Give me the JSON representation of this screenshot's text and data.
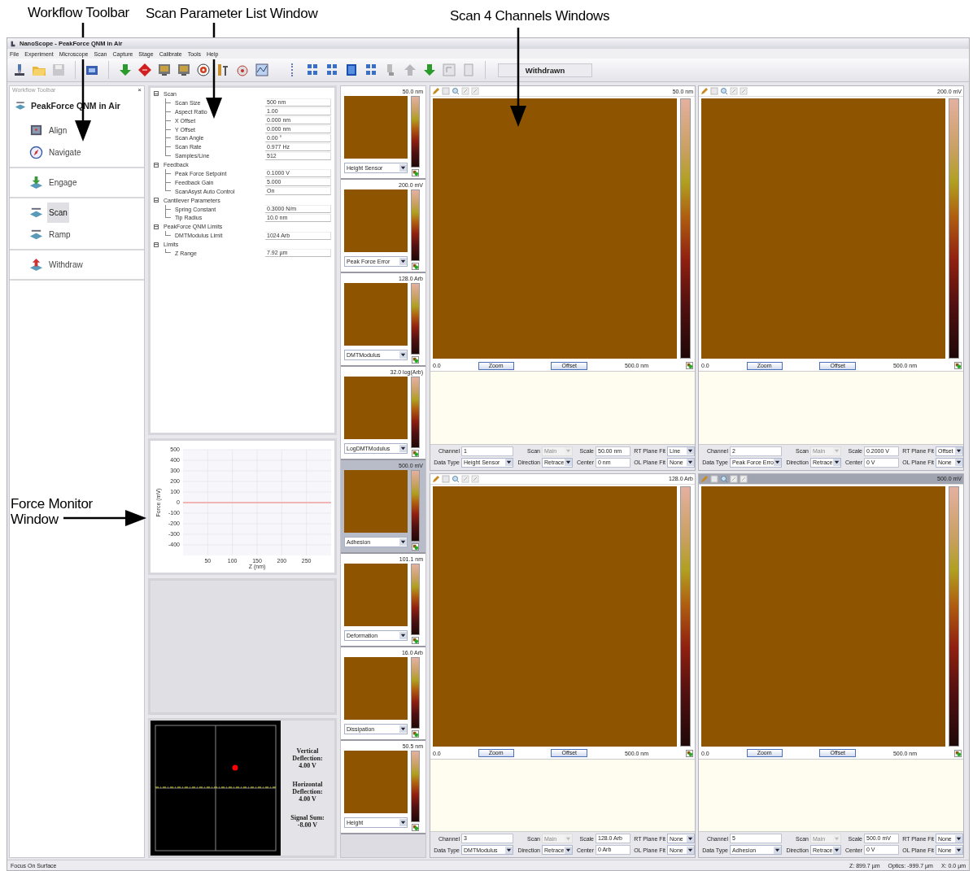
{
  "annotations": {
    "workflow_label": "Workflow Toolbar",
    "params_label": "Scan Parameter List Window",
    "channels_label": "Scan 4 Channels Windows",
    "force_label": "Force Monitor Window"
  },
  "window": {
    "title": "NanoScope - PeakForce QNM in Air"
  },
  "menu": [
    "File",
    "Experiment",
    "Microscope",
    "Scan",
    "Capture",
    "Stage",
    "Calibrate",
    "Tools",
    "Help"
  ],
  "toolbar": {
    "status": "Withdrawn"
  },
  "workflow": {
    "header": "Workflow Toolbar",
    "close": "×",
    "title": "PeakForce QNM in Air",
    "groups": [
      {
        "items": [
          {
            "label": "Align",
            "selected": false
          },
          {
            "label": "Navigate",
            "selected": false
          }
        ]
      },
      {
        "items": [
          {
            "label": "Engage",
            "selected": false
          }
        ]
      },
      {
        "items": [
          {
            "label": "Scan",
            "selected": true
          },
          {
            "label": "Ramp",
            "selected": false
          }
        ]
      },
      {
        "items": [
          {
            "label": "Withdraw",
            "selected": false
          }
        ]
      }
    ]
  },
  "parameters": [
    {
      "group": "Scan",
      "expanded": true,
      "children": [
        {
          "label": "Scan Size",
          "value": "500 nm"
        },
        {
          "label": "Aspect Ratio",
          "value": "1.00"
        },
        {
          "label": "X Offset",
          "value": "0.000 nm"
        },
        {
          "label": "Y Offset",
          "value": "0.000 nm"
        },
        {
          "label": "Scan Angle",
          "value": "0.00 °"
        },
        {
          "label": "Scan Rate",
          "value": "0.977 Hz"
        },
        {
          "label": "Samples/Line",
          "value": "512"
        }
      ]
    },
    {
      "group": "Feedback",
      "expanded": true,
      "children": [
        {
          "label": "Peak Force Setpoint",
          "value": "0.1000 V"
        },
        {
          "label": "Feedback Gain",
          "value": "5.000"
        },
        {
          "label": "ScanAsyst Auto Control",
          "value": "On"
        }
      ]
    },
    {
      "group": "Cantilever Parameters",
      "expanded": true,
      "children": [
        {
          "label": "Spring Constant",
          "value": "0.3000 N/m"
        },
        {
          "label": "Tip Radius",
          "value": "10.0 nm"
        }
      ]
    },
    {
      "group": "PeakForce QNM Limits",
      "expanded": true,
      "children": [
        {
          "label": "DMTModulus Limit",
          "value": "1024 Arb"
        }
      ]
    },
    {
      "group": "Limits",
      "expanded": true,
      "children": [
        {
          "label": "Z Range",
          "value": "7.92 µm"
        }
      ]
    }
  ],
  "force_monitor": {
    "chart_data": {
      "type": "line",
      "grid": true,
      "xlabel": "Z (nm)",
      "ylabel": "Force (mV)",
      "x": [
        0,
        300
      ],
      "series": [
        {
          "color": "#f4a0a0",
          "values": [
            0,
            0
          ]
        }
      ],
      "xlim": [
        0,
        300
      ],
      "ylim": [
        -500,
        500
      ],
      "xticks": [
        50,
        100,
        150,
        200,
        250
      ],
      "yticks": [
        -400,
        -300,
        -200,
        -100,
        0,
        100,
        200,
        300,
        400,
        500
      ]
    }
  },
  "deflection": [
    {
      "label": "Vertical Deflection:",
      "value": "4.00 V"
    },
    {
      "label": "Horizontal Deflection:",
      "value": "4.00 V"
    },
    {
      "label": "Signal Sum:",
      "value": "-8.00 V"
    }
  ],
  "thumbnails": [
    {
      "scale": "50.0 nm",
      "data_type": "Height Sensor",
      "selected": false
    },
    {
      "scale": "200.0 mV",
      "data_type": "Peak Force Error",
      "selected": false
    },
    {
      "scale": "128.0 Arb",
      "data_type": "DMTModulus",
      "selected": false
    },
    {
      "scale": "32.0 log(Arb)",
      "data_type": "LogDMTModulus",
      "selected": false
    },
    {
      "scale": "500.0 mV",
      "data_type": "Adhesion",
      "selected": true
    },
    {
      "scale": "101.1 nm",
      "data_type": "Deformation",
      "selected": false
    },
    {
      "scale": "16.0 Arb",
      "data_type": "Dissipation",
      "selected": false
    },
    {
      "scale": "50.5 nm",
      "data_type": "Height",
      "selected": false
    }
  ],
  "channel_windows": [
    {
      "selected": false,
      "scale": "50.0 nm",
      "axis_start": "0.0",
      "axis_end": "500.0 nm",
      "buttons": [
        "Zoom",
        "Offset"
      ],
      "fields": [
        {
          "label": "Channel",
          "value": "1",
          "kind": "text",
          "disabled": false
        },
        {
          "label": "Scan",
          "value": "Main",
          "kind": "select",
          "disabled": true
        },
        {
          "label": "Scale",
          "value": "50.00 nm",
          "kind": "text",
          "disabled": false
        },
        {
          "label": "RT Plane Fit",
          "value": "Line",
          "kind": "select",
          "disabled": false
        },
        {
          "label": "Data Type",
          "value": "Height Sensor",
          "kind": "select",
          "disabled": false
        },
        {
          "label": "Direction",
          "value": "Retrace",
          "kind": "select",
          "disabled": false
        },
        {
          "label": "Center",
          "value": "0 nm",
          "kind": "text",
          "disabled": false
        },
        {
          "label": "OL Plane Fit",
          "value": "None",
          "kind": "select",
          "disabled": false
        }
      ]
    },
    {
      "selected": false,
      "scale": "200.0 mV",
      "axis_start": "0.0",
      "axis_end": "500.0 nm",
      "buttons": [
        "Zoom",
        "Offset"
      ],
      "fields": [
        {
          "label": "Channel",
          "value": "2",
          "kind": "text",
          "disabled": false
        },
        {
          "label": "Scan",
          "value": "Main",
          "kind": "select",
          "disabled": true
        },
        {
          "label": "Scale",
          "value": "0.2000 V",
          "kind": "text",
          "disabled": false
        },
        {
          "label": "RT Plane Fit",
          "value": "Offset",
          "kind": "select",
          "disabled": false
        },
        {
          "label": "Data Type",
          "value": "Peak Force Erro",
          "kind": "select",
          "disabled": false
        },
        {
          "label": "Direction",
          "value": "Retrace",
          "kind": "select",
          "disabled": false
        },
        {
          "label": "Center",
          "value": "0 V",
          "kind": "text",
          "disabled": false
        },
        {
          "label": "OL Plane Fit",
          "value": "None",
          "kind": "select",
          "disabled": false
        }
      ]
    },
    {
      "selected": false,
      "scale": "128.0 Arb",
      "axis_start": "0.0",
      "axis_end": "500.0 nm",
      "buttons": [
        "Zoom",
        "Offset"
      ],
      "fields": [
        {
          "label": "Channel",
          "value": "3",
          "kind": "text",
          "disabled": false
        },
        {
          "label": "Scan",
          "value": "Main",
          "kind": "select",
          "disabled": true
        },
        {
          "label": "Scale",
          "value": "128.0 Arb",
          "kind": "text",
          "disabled": false
        },
        {
          "label": "RT Plane Fit",
          "value": "None",
          "kind": "select",
          "disabled": false
        },
        {
          "label": "Data Type",
          "value": "DMTModulus",
          "kind": "select",
          "disabled": false
        },
        {
          "label": "Direction",
          "value": "Retrace",
          "kind": "select",
          "disabled": false
        },
        {
          "label": "Center",
          "value": "0 Arb",
          "kind": "text",
          "disabled": false
        },
        {
          "label": "OL Plane Fit",
          "value": "None",
          "kind": "select",
          "disabled": false
        }
      ]
    },
    {
      "selected": true,
      "scale": "500.0 mV",
      "axis_start": "0.0",
      "axis_end": "500.0 nm",
      "buttons": [
        "Zoom",
        "Offset"
      ],
      "fields": [
        {
          "label": "Channel",
          "value": "5",
          "kind": "text",
          "disabled": false
        },
        {
          "label": "Scan",
          "value": "Main",
          "kind": "select",
          "disabled": true
        },
        {
          "label": "Scale",
          "value": "500.0 mV",
          "kind": "text",
          "disabled": false
        },
        {
          "label": "RT Plane Fit",
          "value": "None",
          "kind": "select",
          "disabled": false
        },
        {
          "label": "Data Type",
          "value": "Adhesion",
          "kind": "select",
          "disabled": false
        },
        {
          "label": "Direction",
          "value": "Retrace",
          "kind": "select",
          "disabled": false
        },
        {
          "label": "Center",
          "value": "0 V",
          "kind": "text",
          "disabled": false
        },
        {
          "label": "OL Plane Fit",
          "value": "None",
          "kind": "select",
          "disabled": false
        }
      ]
    }
  ],
  "status_bar": {
    "message": "Focus On Surface",
    "readouts": [
      "Z: 899.7 µm",
      "Optics: -999.7 µm",
      "X: 0.0 µm"
    ]
  }
}
